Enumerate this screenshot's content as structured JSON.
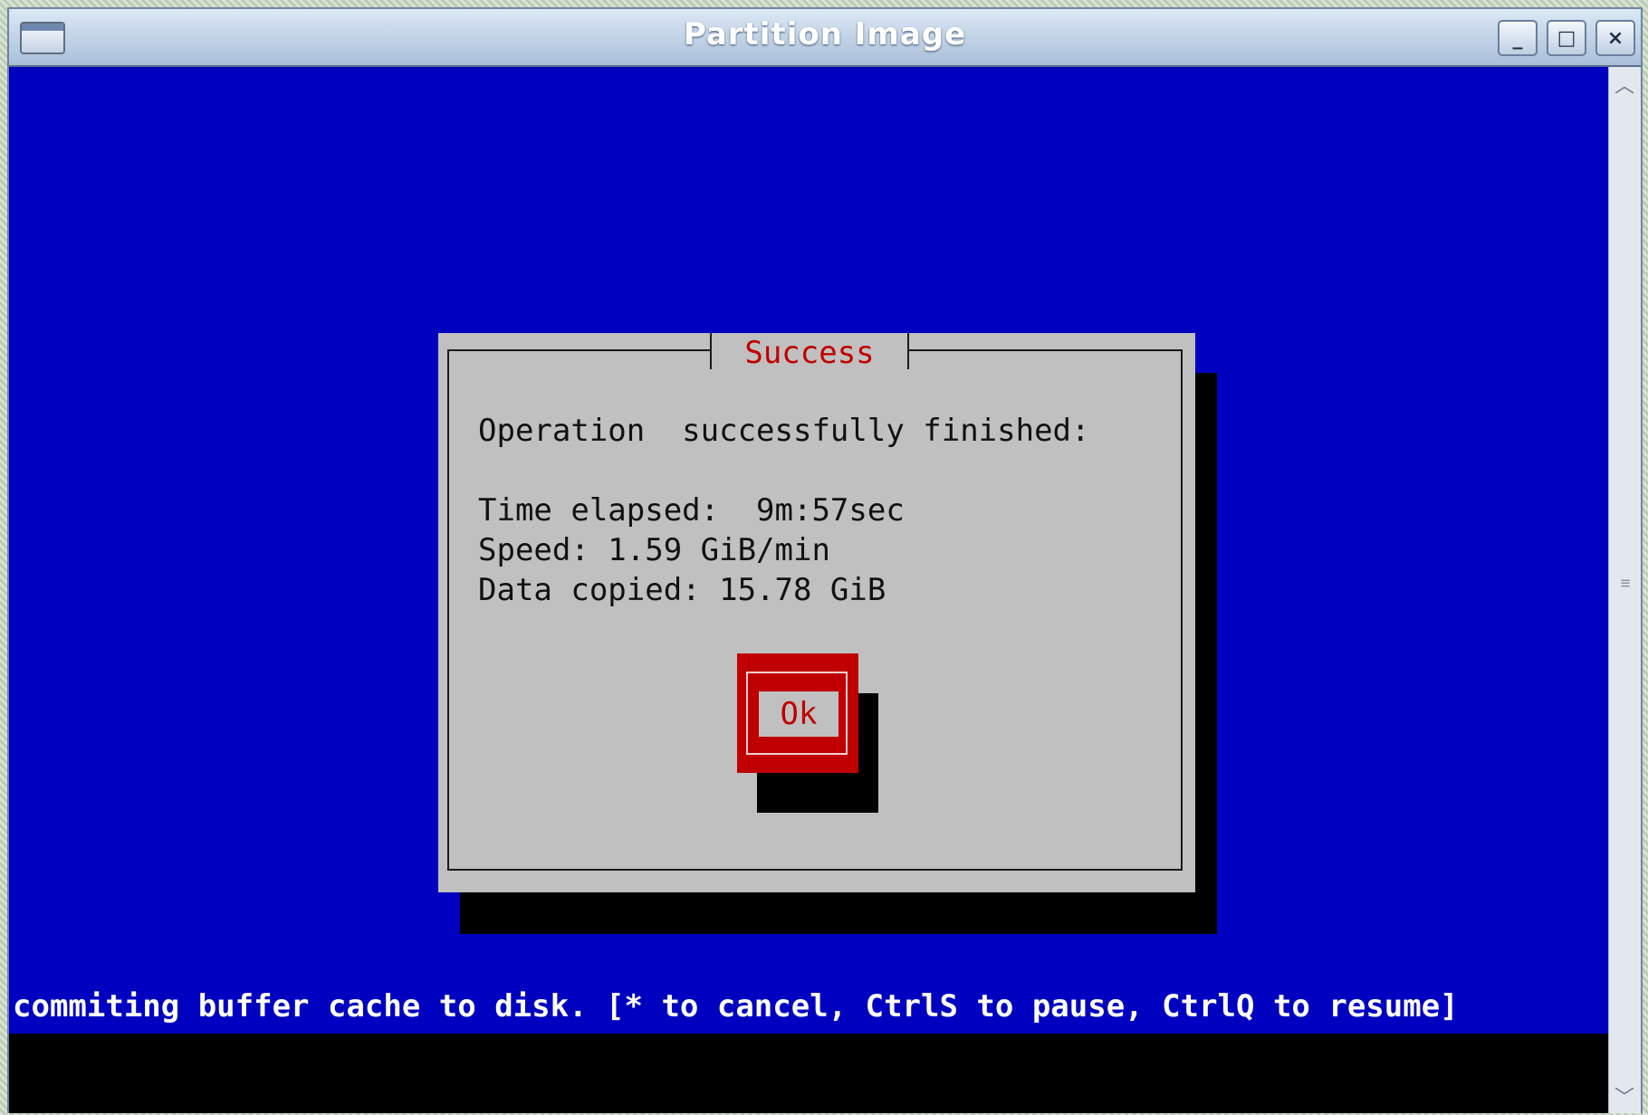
{
  "window": {
    "title": "Partition Image",
    "controls": {
      "minimize": "_",
      "maximize": "□",
      "close": "×"
    }
  },
  "dialog": {
    "title": "Success",
    "message": "Operation  successfully finished:",
    "time_elapsed": "Time elapsed:  9m:57sec",
    "speed": "Speed: 1.59 GiB/min",
    "data_copied": "Data copied: 15.78 GiB",
    "ok_label": "Ok"
  },
  "status": {
    "text": "commiting buffer cache to disk. [* to cancel, CtrlS to pause, CtrlQ to resume]"
  },
  "colors": {
    "terminal_bg": "#0000c0",
    "dialog_bg": "#c0c0c0",
    "accent": "#c00000",
    "shadow": "#000000"
  },
  "icons": {
    "window_menu": "window-icon",
    "scroll_up": "arrow-up-icon",
    "scroll_down": "arrow-down-icon",
    "grip": "grip-icon"
  }
}
